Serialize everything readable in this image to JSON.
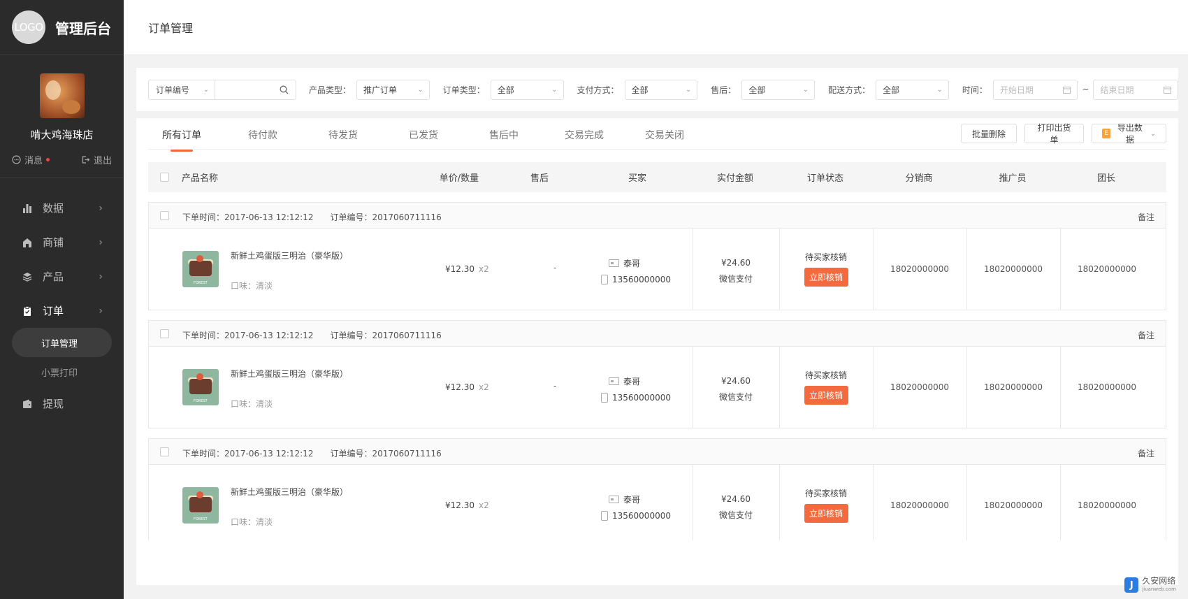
{
  "sidebar": {
    "logo_text": "LOGO",
    "brand_title": "管理后台",
    "shop_name": "啃大鸡海珠店",
    "messages_label": "消息",
    "logout_label": "退出",
    "nav": [
      {
        "label": "数据",
        "icon": "bar-chart-icon"
      },
      {
        "label": "商铺",
        "icon": "shop-icon"
      },
      {
        "label": "产品",
        "icon": "layers-icon"
      },
      {
        "label": "订单",
        "icon": "clipboard-icon"
      },
      {
        "label": "提现",
        "icon": "wallet-icon"
      }
    ],
    "sub_items": [
      "订单管理",
      "小票打印"
    ]
  },
  "header": {
    "title": "订单管理"
  },
  "filters": {
    "order_no_select": "订单编号",
    "product_type_label": "产品类型：",
    "product_type_value": "推广订单",
    "order_type_label": "订单类型：",
    "order_type_value": "全部",
    "payment_label": "支付方式：",
    "payment_value": "全部",
    "after_sale_label": "售后：",
    "after_sale_value": "全部",
    "delivery_label": "配送方式：",
    "delivery_value": "全部",
    "time_label": "时间：",
    "start_placeholder": "开始日期",
    "tilde": "~",
    "end_placeholder": "结束日期"
  },
  "tabs": [
    "所有订单",
    "待付款",
    "待发货",
    "已发货",
    "售后中",
    "交易完成",
    "交易关闭"
  ],
  "actions": {
    "batch_delete": "批量删除",
    "print": "打印出货单",
    "export_icon": "E",
    "export": "导出数据"
  },
  "columns": [
    "产品名称",
    "单价/数量",
    "售后",
    "买家",
    "实付金额",
    "订单状态",
    "分销商",
    "推广员",
    "团长"
  ],
  "order_head": {
    "time_label": "下单时间：",
    "no_label": "订单编号：",
    "remark": "备注"
  },
  "orders": [
    {
      "time": "2017-06-13 12:12:12",
      "no": "2017060711116",
      "img_text": "FOREST",
      "name": "新鲜土鸡蛋版三明治（豪华版）",
      "flavor": "口味：清淡",
      "price": "¥12.30",
      "qty": "x2",
      "after_sale": "-",
      "buyer": "泰哥",
      "phone": "13560000000",
      "amount": "¥24.60",
      "pay": "微信支付",
      "status": "待买家核销",
      "action": "立即核销",
      "distributor": "18020000000",
      "promoter": "18020000000",
      "leader": "18020000000"
    },
    {
      "time": "2017-06-13 12:12:12",
      "no": "2017060711116",
      "img_text": "FOREST",
      "name": "新鲜土鸡蛋版三明治（豪华版）",
      "flavor": "口味：清淡",
      "price": "¥12.30",
      "qty": "x2",
      "after_sale": "-",
      "buyer": "泰哥",
      "phone": "13560000000",
      "amount": "¥24.60",
      "pay": "微信支付",
      "status": "待买家核销",
      "action": "立即核销",
      "distributor": "18020000000",
      "promoter": "18020000000",
      "leader": "18020000000"
    },
    {
      "time": "2017-06-13 12:12:12",
      "no": "2017060711116",
      "img_text": "FOREST",
      "name": "新鲜土鸡蛋版三明治（豪华版）",
      "flavor": "口味：清淡",
      "price": "¥12.30",
      "qty": "x2",
      "after_sale": "",
      "buyer": "泰哥",
      "phone": "13560000000",
      "amount": "¥24.60",
      "pay": "微信支付",
      "status": "待买家核销",
      "action": "立即核销",
      "distributor": "18020000000",
      "promoter": "18020000000",
      "leader": "18020000000"
    }
  ],
  "watermark": {
    "logo": "J",
    "title": "久安网络",
    "url": "jiuanweb.com"
  },
  "colors": {
    "accent": "#f26a3e",
    "sidebar": "#2b2b2b"
  }
}
